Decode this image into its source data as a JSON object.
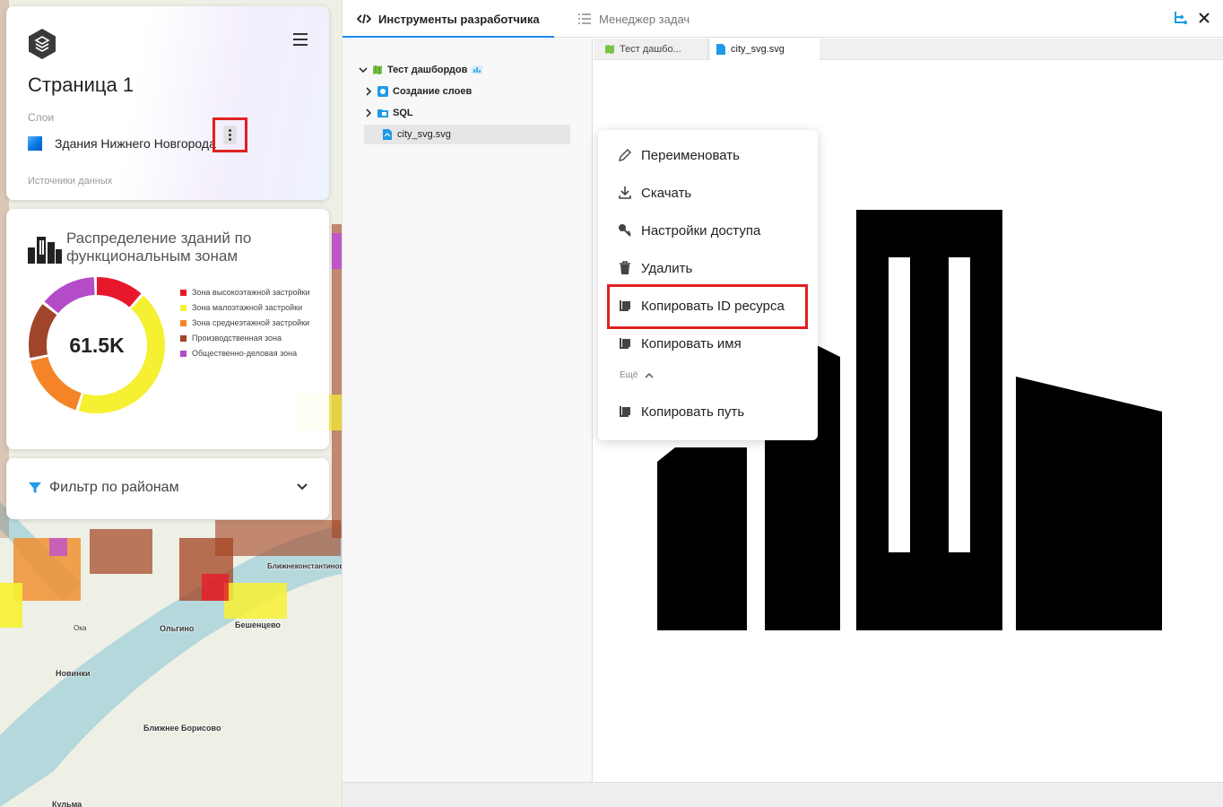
{
  "map": {
    "labels": [
      "Ольгино",
      "Новинки",
      "Ближнее Борисово",
      "Кульма",
      "Бешенцево",
      "Ближнеконстантиново",
      "Ока"
    ]
  },
  "sidebar": {
    "page_title": "Страница 1",
    "layers_label": "Слои",
    "layer_name": "Здания Нижнего Новгорода",
    "sources_label": "Источники данных"
  },
  "widget": {
    "title": "Распределение зданий по функциональным зонам",
    "total": "61.5K",
    "legend": [
      {
        "label": "Зона высокоэтажной застройки",
        "color": "#e8182c"
      },
      {
        "label": "Зона малоэтажной застройки",
        "color": "#f5f032"
      },
      {
        "label": "Зона среднеэтажной застройки",
        "color": "#f58428"
      },
      {
        "label": "Производственная зона",
        "color": "#a0452a"
      },
      {
        "label": "Общественно-деловая зона",
        "color": "#b44cc8"
      }
    ],
    "slices": [
      {
        "name": "Зона высокоэтажной застройки",
        "value": 0.12,
        "color": "#e8182c"
      },
      {
        "name": "Зона малоэтажной застройки",
        "value": 0.43,
        "color": "#f5f032"
      },
      {
        "name": "Зона среднеэтажной застройки",
        "value": 0.17,
        "color": "#f58428"
      },
      {
        "name": "Производственная зона",
        "value": 0.14,
        "color": "#a0452a"
      },
      {
        "name": "Общественно-деловая зона",
        "value": 0.14,
        "color": "#b44cc8"
      }
    ]
  },
  "filter": {
    "label": "Фильтр по районам"
  },
  "devtools": {
    "tab_dev": "Инструменты разработчика",
    "tab_tasks": "Менеджер задач",
    "tree": {
      "root": "Тест дашбордов",
      "items": [
        "Создание слоев",
        "SQL"
      ],
      "file": "city_svg.svg"
    },
    "editor_tabs": [
      "Тест дашбо...",
      "city_svg.svg"
    ]
  },
  "context_menu": {
    "items": [
      "Переименовать",
      "Скачать",
      "Настройки доступа",
      "Удалить",
      "Копировать ID ресурса",
      "Копировать имя"
    ],
    "more_label": "Ещё",
    "extra_item": "Копировать путь"
  },
  "colors": {
    "accent": "#1e88e5",
    "highlight": "#e02020"
  }
}
